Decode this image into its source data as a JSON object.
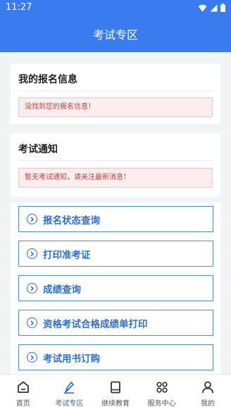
{
  "status_bar": {
    "time": "11:27"
  },
  "header": {
    "title": "考试专区"
  },
  "registration_card": {
    "title": "我的报名信息",
    "alert": "没找到您的报名信息！"
  },
  "notice_card": {
    "title": "考试通知",
    "alert": "暂无考试通知，请关注最新消息！"
  },
  "menu": [
    {
      "label": "报名状态查询"
    },
    {
      "label": "打印准考证"
    },
    {
      "label": "成绩查询"
    },
    {
      "label": "资格考试合格成绩单打印"
    },
    {
      "label": "考试用书订购"
    }
  ],
  "tabbar": {
    "active_color": "#2c6fd6",
    "items": [
      {
        "label": "首页",
        "icon": "home-icon"
      },
      {
        "label": "考试专区",
        "icon": "pen-icon"
      },
      {
        "label": "继续教育",
        "icon": "book-icon"
      },
      {
        "label": "服务中心",
        "icon": "grid-icon"
      },
      {
        "label": "我的",
        "icon": "person-icon"
      }
    ]
  }
}
